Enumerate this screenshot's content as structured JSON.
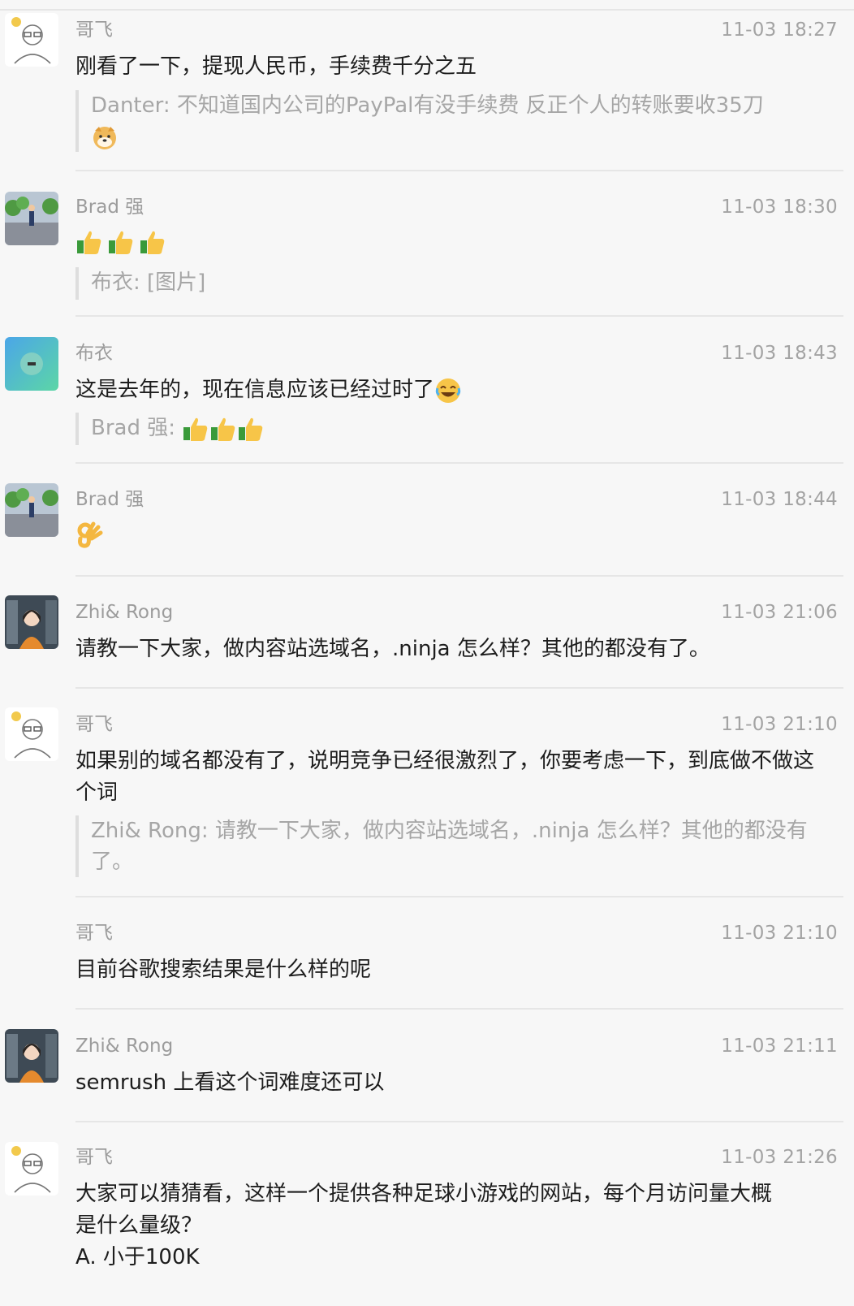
{
  "messages": [
    {
      "sender": "哥飞",
      "time": "11-03 18:27",
      "text": "刚看了一下，提现人民币，手续费千分之五",
      "quote": "Danter: 不知道国内公司的PayPal有没手续费 反正个人的转账要收35刀",
      "quote_emoji": "doge-icon"
    },
    {
      "sender": "Brad 强",
      "time": "11-03 18:30",
      "emojis": [
        "thumbs-up-icon",
        "thumbs-up-icon",
        "thumbs-up-icon"
      ],
      "quote": "布衣: [图片]"
    },
    {
      "sender": "布衣",
      "time": "11-03 18:43",
      "text": "这是去年的，现在信息应该已经过时了",
      "text_emoji": "joy-icon",
      "quote": "Brad 强:"
    },
    {
      "sender": "Brad 强",
      "time": "11-03 18:44",
      "emojis": [
        "ok-hand-icon"
      ]
    },
    {
      "sender": "Zhi& Rong",
      "time": "11-03 21:06",
      "text": "请教一下大家，做内容站选域名，.ninja 怎么样？其他的都没有了。"
    },
    {
      "sender": "哥飞",
      "time": "11-03 21:10",
      "text": "如果别的域名都没有了，说明竞争已经很激烈了，你要考虑一下，到底做不做这个词",
      "quote": "Zhi& Rong: 请教一下大家，做内容站选域名，.ninja 怎么样？其他的都没有了。"
    },
    {
      "sender": "哥飞",
      "time": "11-03 21:10",
      "text": "目前谷歌搜索结果是什么样的呢"
    },
    {
      "sender": "Zhi& Rong",
      "time": "11-03 21:11",
      "text": "semrush 上看这个词难度还可以"
    },
    {
      "sender": "哥飞",
      "time": "11-03 21:26",
      "text_lines": [
        "大家可以猜猜看，这样一个提供各种足球小游戏的网站，每个月访问量大概",
        "是什么量级？",
        "A. 小于100K"
      ]
    }
  ],
  "colors": {
    "background": "#f7f7f7",
    "text": "#1d1d1d",
    "meta": "#9c9c9c",
    "quote": "#a6a6a6",
    "divider": "#e6e6e6"
  }
}
